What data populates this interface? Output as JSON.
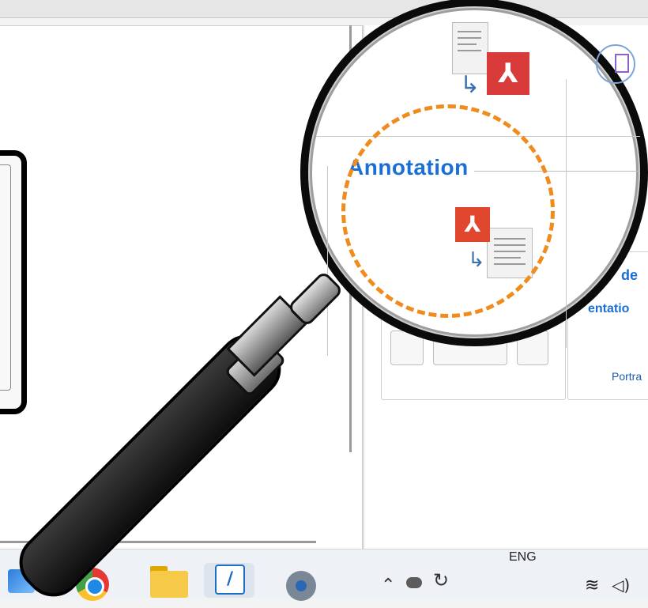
{
  "ribbon": {
    "group_label": "Annotation",
    "cut_text_1": "de",
    "cut_text_2": "entatio",
    "orientation_value": "Portra"
  },
  "taskbar": {
    "language": "ENG",
    "icons": [
      "photos-icon",
      "chrome-icon",
      "file-explorer-icon",
      "active-app-icon",
      "settings-icon",
      "chevron-up-icon",
      "cloud-icon",
      "sync-icon",
      "wifi-icon",
      "volume-icon"
    ]
  },
  "overlay": {
    "magnifier": "magnifying-glass-icon",
    "highlight_color": "#f08c1e"
  },
  "colors": {
    "accent": "#1a6fd6",
    "pdf_red": "#d93a3a"
  }
}
